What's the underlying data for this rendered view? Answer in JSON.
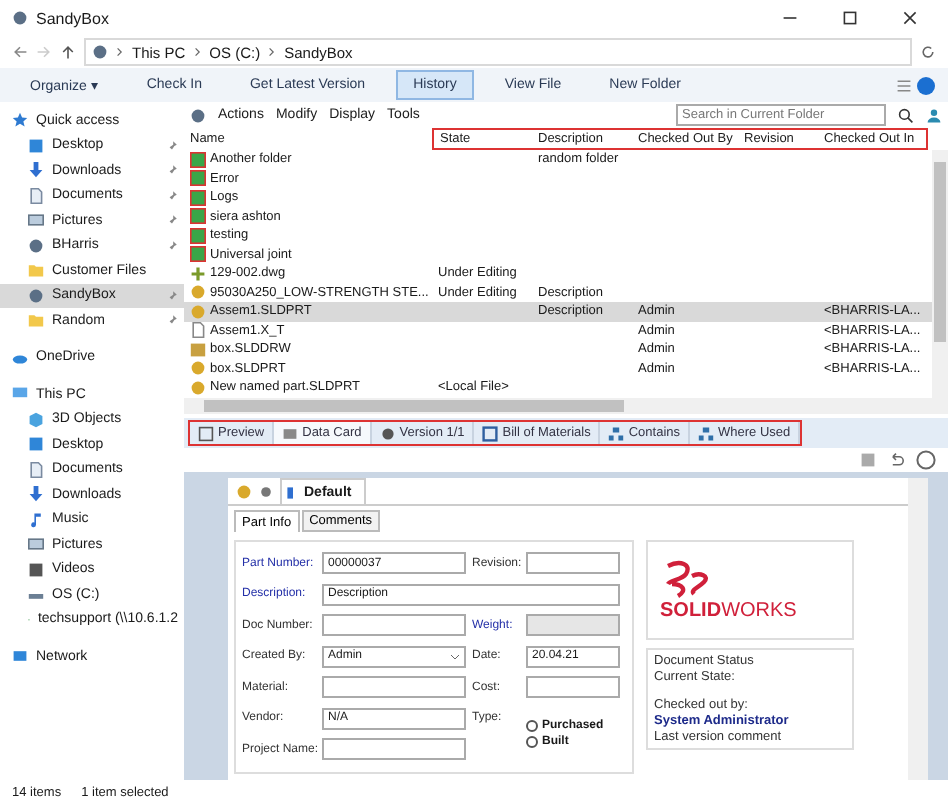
{
  "window": {
    "title": "SandyBox"
  },
  "address": {
    "crumbs": [
      "This PC",
      "OS (C:)",
      "SandyBox"
    ]
  },
  "toolbar": {
    "buttons": [
      {
        "label": "Organize ▾",
        "selected": false
      },
      {
        "label": "Check In",
        "selected": false
      },
      {
        "label": "Get Latest Version",
        "selected": false
      },
      {
        "label": "History",
        "selected": true
      },
      {
        "label": "View File",
        "selected": false
      },
      {
        "label": "New Folder",
        "selected": false
      }
    ]
  },
  "pdm_menu": [
    "Actions",
    "Modify",
    "Display",
    "Tools"
  ],
  "search": {
    "placeholder": "Search in Current Folder"
  },
  "sidebar": {
    "sections": [
      {
        "label": "Quick access",
        "kind": "star",
        "children": [
          {
            "label": "Desktop",
            "kind": "desktop",
            "pinned": true,
            "selected": false
          },
          {
            "label": "Downloads",
            "kind": "download",
            "pinned": true,
            "selected": false
          },
          {
            "label": "Documents",
            "kind": "document",
            "pinned": true,
            "selected": false
          },
          {
            "label": "Pictures",
            "kind": "picture",
            "pinned": true,
            "selected": false
          },
          {
            "label": "BHarris",
            "kind": "vault",
            "pinned": true,
            "selected": false
          },
          {
            "label": "Customer Files",
            "kind": "folder",
            "pinned": false,
            "selected": false
          },
          {
            "label": "SandyBox",
            "kind": "vault",
            "pinned": true,
            "selected": true
          },
          {
            "label": "Random",
            "kind": "folder",
            "pinned": true,
            "selected": false
          }
        ]
      },
      {
        "label": "OneDrive",
        "kind": "cloud"
      },
      {
        "label": "This PC",
        "kind": "pc",
        "children": [
          {
            "label": "3D Objects",
            "kind": "cube",
            "pinned": false,
            "selected": false
          },
          {
            "label": "Desktop",
            "kind": "desktop",
            "pinned": false,
            "selected": false
          },
          {
            "label": "Documents",
            "kind": "document",
            "pinned": false,
            "selected": false
          },
          {
            "label": "Downloads",
            "kind": "download",
            "pinned": false,
            "selected": false
          },
          {
            "label": "Music",
            "kind": "music",
            "pinned": false,
            "selected": false
          },
          {
            "label": "Pictures",
            "kind": "picture",
            "pinned": false,
            "selected": false
          },
          {
            "label": "Videos",
            "kind": "video",
            "pinned": false,
            "selected": false
          },
          {
            "label": "OS (C:)",
            "kind": "drive",
            "pinned": false,
            "selected": false
          },
          {
            "label": "techsupport (\\\\10.6.1.2",
            "kind": "netdrive",
            "pinned": false,
            "selected": false
          }
        ]
      },
      {
        "label": "Network",
        "kind": "network"
      }
    ]
  },
  "table": {
    "columns": [
      "Name",
      "State",
      "Description",
      "Checked Out By",
      "Revision",
      "Checked Out In"
    ],
    "rows": [
      {
        "kind": "folder",
        "selected": false,
        "cells": [
          "Another folder",
          null,
          "random folder",
          null,
          null,
          null
        ]
      },
      {
        "kind": "folder",
        "selected": false,
        "cells": [
          "Error",
          null,
          null,
          null,
          null,
          null
        ]
      },
      {
        "kind": "folder",
        "selected": false,
        "cells": [
          "Logs",
          null,
          null,
          null,
          null,
          null
        ]
      },
      {
        "kind": "folder",
        "selected": false,
        "cells": [
          "siera ashton",
          null,
          null,
          null,
          null,
          null
        ]
      },
      {
        "kind": "folder",
        "selected": false,
        "cells": [
          "testing",
          null,
          null,
          null,
          null,
          null
        ]
      },
      {
        "kind": "folder",
        "selected": false,
        "cells": [
          "Universal joint",
          null,
          null,
          null,
          null,
          null
        ]
      },
      {
        "kind": "drawing",
        "selected": false,
        "cells": [
          "129-002.dwg",
          "Under Editing",
          null,
          null,
          null,
          null
        ]
      },
      {
        "kind": "part",
        "selected": false,
        "cells": [
          "95030A250_LOW-STRENGTH STE...",
          "Under Editing",
          "Description",
          null,
          null,
          null
        ]
      },
      {
        "kind": "part",
        "selected": true,
        "cells": [
          "Assem1.SLDPRT",
          null,
          "Description",
          "Admin",
          null,
          "<BHARRIS-LA..."
        ]
      },
      {
        "kind": "text",
        "selected": false,
        "cells": [
          "Assem1.X_T",
          null,
          null,
          "Admin",
          null,
          "<BHARRIS-LA..."
        ]
      },
      {
        "kind": "sheet",
        "selected": false,
        "cells": [
          "box.SLDDRW",
          null,
          null,
          "Admin",
          null,
          "<BHARRIS-LA..."
        ]
      },
      {
        "kind": "part",
        "selected": false,
        "cells": [
          "box.SLDPRT",
          null,
          null,
          "Admin",
          null,
          "<BHARRIS-LA..."
        ]
      },
      {
        "kind": "part",
        "selected": false,
        "cells": [
          "New named part.SLDPRT",
          "<Local File>",
          null,
          null,
          null,
          null
        ]
      }
    ]
  },
  "view_tabs": [
    {
      "label": "Preview",
      "kind": "preview",
      "selected": false
    },
    {
      "label": "Data Card",
      "kind": "card",
      "selected": true
    },
    {
      "label": "Version 1/1",
      "kind": "version",
      "selected": false
    },
    {
      "label": "Bill of Materials",
      "kind": "table",
      "selected": false
    },
    {
      "label": "Contains",
      "kind": "tree",
      "selected": false
    },
    {
      "label": "Where Used",
      "kind": "tree",
      "selected": false
    }
  ],
  "data_card": {
    "configuration": "Default",
    "tabs": [
      {
        "label": "Part Info",
        "selected": true
      },
      {
        "label": "Comments",
        "selected": false
      }
    ],
    "fields": [
      {
        "label": "Part Number:",
        "value": "00000037",
        "kind": "text",
        "required": true
      },
      {
        "label": "Revision:",
        "kind": "text",
        "required": false
      },
      {
        "label": "Description:",
        "value": "Description",
        "kind": "wide",
        "required": true
      },
      {
        "label": "Doc Number:",
        "kind": "text",
        "required": false
      },
      {
        "label": "Weight:",
        "kind": "disabled",
        "required": true
      },
      {
        "label": "Created By:",
        "value": "Admin",
        "kind": "dropdown",
        "required": false
      },
      {
        "label": "Date:",
        "value": "20.04.21",
        "kind": "text",
        "required": false
      },
      {
        "label": "Material:",
        "kind": "text",
        "required": false
      },
      {
        "label": "Cost:",
        "kind": "text",
        "required": false
      },
      {
        "label": "Vendor:",
        "value": "N/A",
        "kind": "text",
        "required": false
      },
      {
        "label": "Type:",
        "kind": "radio",
        "required": false,
        "options": [
          {
            "label": "Purchased",
            "selected": false
          },
          {
            "label": "Built",
            "selected": false
          }
        ]
      },
      {
        "label": "Project Name:",
        "kind": "text",
        "required": false
      }
    ],
    "logo": {
      "brand_bold": "SOLID",
      "brand_light": "WORKS"
    },
    "status": {
      "title": "Document Status",
      "current_state": "Current State:",
      "checked_out_label": "Checked out by:",
      "checked_out_by": "System Administrator",
      "comment_label": "Last version comment"
    }
  },
  "status_bar": [
    "14 items",
    "1 item selected"
  ]
}
